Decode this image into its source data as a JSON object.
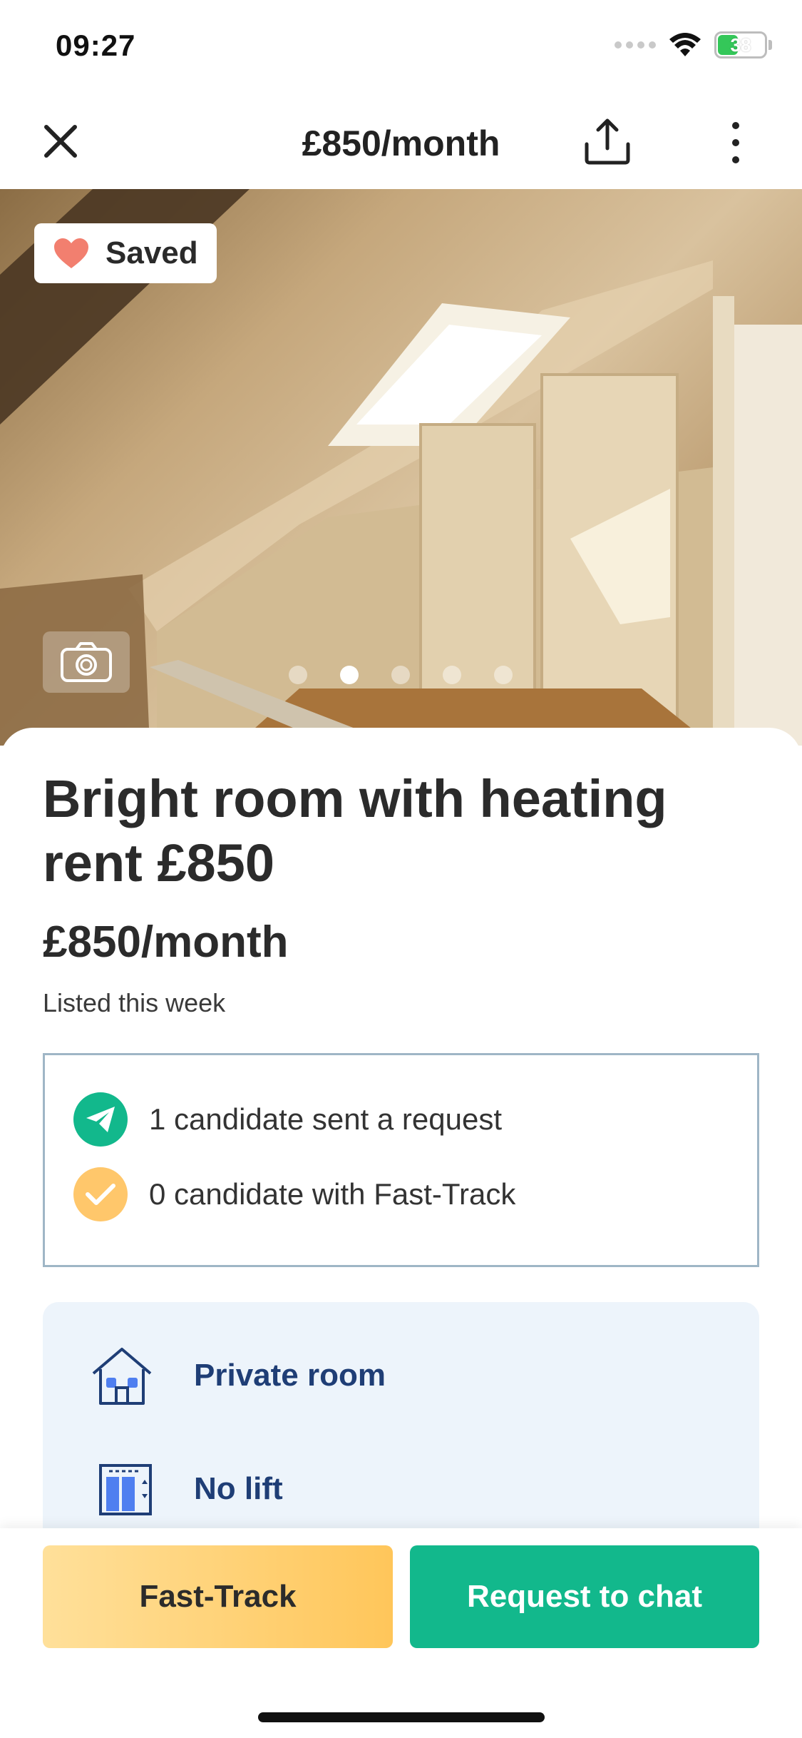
{
  "status_bar": {
    "time": "09:27",
    "battery": "38",
    "icons": [
      "cellular-signal-icon",
      "wifi-icon",
      "battery-charging-icon"
    ]
  },
  "header": {
    "title": "£850/month",
    "icons": [
      "close-icon",
      "share-icon",
      "more-vertical-icon"
    ]
  },
  "gallery": {
    "saved_label": "Saved",
    "dot_count": 5,
    "active_dot": 2
  },
  "listing": {
    "title": "Bright room with heating rent £850",
    "price": "£850/month",
    "listed": "Listed this week"
  },
  "candidates": {
    "requests": "1 candidate sent a request",
    "fast_track": "0 candidate with Fast-Track"
  },
  "features": [
    {
      "icon": "house-icon",
      "label": "Private room"
    },
    {
      "icon": "lift-icon",
      "label": "No lift"
    }
  ],
  "actions": {
    "fast_track_label": "Fast-Track",
    "chat_label": "Request to chat"
  },
  "colors": {
    "accent_green": "#12b88c",
    "accent_yellow": "#ffc65a",
    "feature_text": "#1f3e76",
    "feature_bg": "#edf4fb"
  }
}
